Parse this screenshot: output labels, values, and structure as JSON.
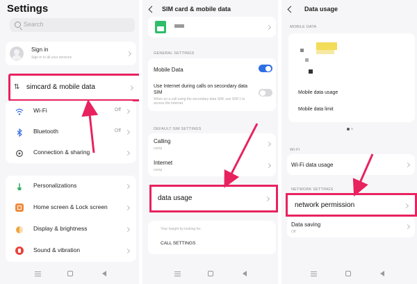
{
  "settings": {
    "title": "Settings",
    "search_placeholder": "Search",
    "sign_in": {
      "label": "Sign in",
      "sub": "Sign in to all your services"
    },
    "items": [
      {
        "label": "simcard & mobile data"
      },
      {
        "label": "Wi-Fi",
        "value": "Off"
      },
      {
        "label": "Bluetooth",
        "value": "Off"
      },
      {
        "label": "Connection & sharing"
      },
      {
        "label": "Personalizations"
      },
      {
        "label": "Home screen & Lock screen"
      },
      {
        "label": "Display & brightness"
      },
      {
        "label": "Sound & vibration"
      }
    ]
  },
  "sim": {
    "title": "SIM card & mobile data",
    "general_header": "GENERAL SETTINGS",
    "mobile_data": "Mobile Data",
    "use_internet": "Use Internet during calls on secondary data SIM",
    "use_internet_sub": "When on a call using the secondary data SIM, use SIM 1 to access the internet.",
    "default_header": "DEFAULT SIM SETTINGS",
    "calling": "Calling",
    "calling_sub": "comp",
    "internet": "Internet",
    "internet_sub": "comp",
    "data_usage": "data usage",
    "footer_hint": "Your Insight by looking for:",
    "call_settings": "CALL SETTINGS"
  },
  "data_usage": {
    "title": "Data usage",
    "mobile_header": "MOBILE DATA",
    "mobile_usage": "Mobile data usage",
    "mobile_limit": "Mobile data limit",
    "wifi_header": "WI-FI",
    "wifi_usage": "Wi-Fi data usage",
    "network_header": "NETWORK SETTINGS",
    "network_permission": "network permission",
    "data_saving": "Data saving",
    "data_saving_sub": "Off"
  },
  "colors": {
    "accent": "#e8225f",
    "toggle_on": "#2f6fe4",
    "toggle_off": "#d9d9dd"
  },
  "icons": [
    "search-icon",
    "avatar-icon",
    "sim-icon",
    "wifi-icon",
    "bluetooth-icon",
    "connection-icon",
    "palette-icon",
    "home-screen-icon",
    "display-icon",
    "sound-icon",
    "back-arrow-icon",
    "chevron-right-icon",
    "nav-menu-icon",
    "nav-home-icon",
    "nav-back-icon"
  ]
}
